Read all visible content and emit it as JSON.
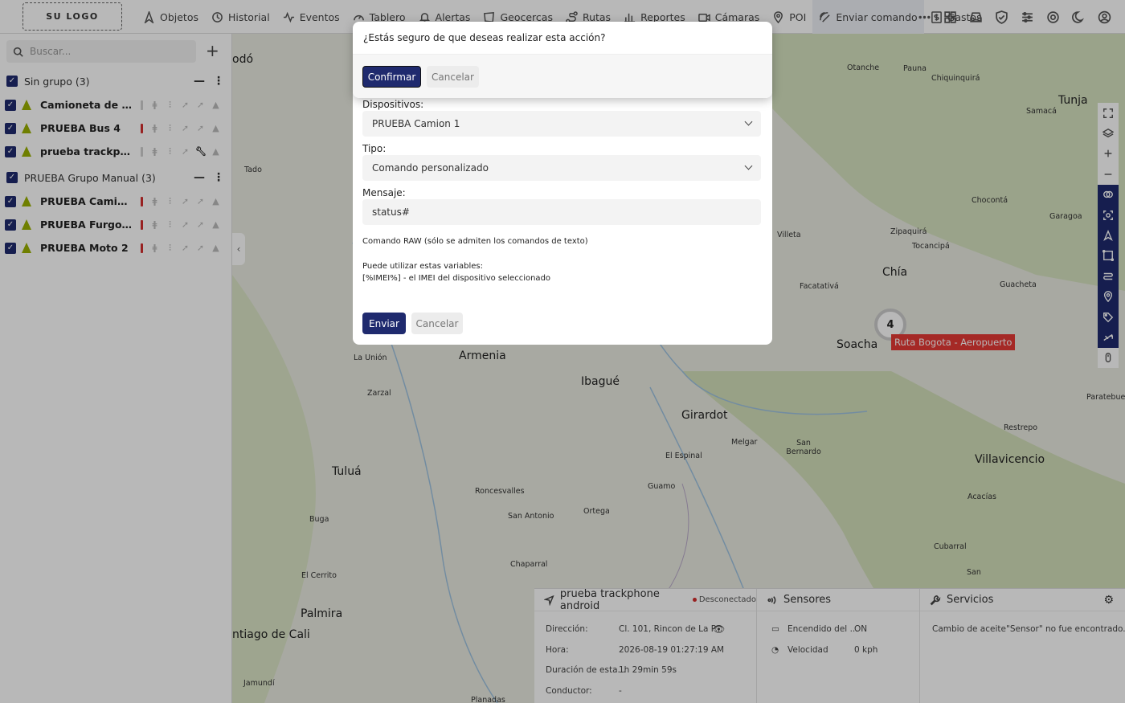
{
  "header": {
    "logo": "SU LOGO",
    "nav": [
      {
        "label": "Objetos",
        "icon": "navigation-icon"
      },
      {
        "label": "Historial",
        "icon": "history-icon"
      },
      {
        "label": "Eventos",
        "icon": "activity-icon"
      },
      {
        "label": "Tablero",
        "icon": "gauge-icon"
      },
      {
        "label": "Alertas",
        "icon": "bell-icon"
      },
      {
        "label": "Geocercas",
        "icon": "geofence-icon"
      },
      {
        "label": "Rutas",
        "icon": "route-icon"
      },
      {
        "label": "Reportes",
        "icon": "chart-bar-icon"
      },
      {
        "label": "Cámaras",
        "icon": "camera-icon"
      },
      {
        "label": "POI",
        "icon": "poi-icon"
      },
      {
        "label": "Enviar comando",
        "icon": "send-command-icon"
      },
      {
        "label": "Gastos",
        "icon": "dollar-icon"
      }
    ],
    "right_icons": [
      "more-icon",
      "apps-grid-icon",
      "inbox-icon",
      "shield-icon",
      "sliders-icon",
      "support-icon",
      "moon-icon",
      "user-icon"
    ]
  },
  "sidebar": {
    "search_placeholder": "Buscar...",
    "groups": [
      {
        "name": "Sin grupo (3)",
        "devices": [
          {
            "name": "Camioneta de rep...",
            "status_color": "#cccccc",
            "tools": false
          },
          {
            "name": "PRUEBA Bus 4",
            "status_color": "#d32f2f",
            "tools": false
          },
          {
            "name": "prueba trackphon...",
            "status_color": "#cccccc",
            "tools": true
          }
        ]
      },
      {
        "name": "PRUEBA Grupo Manual (3)",
        "devices": [
          {
            "name": "PRUEBA Camion 1",
            "status_color": "#d32f2f",
            "tools": false
          },
          {
            "name": "PRUEBA Furgon 3",
            "status_color": "#d32f2f",
            "tools": false
          },
          {
            "name": "PRUEBA Moto 2",
            "status_color": "#d32f2f",
            "tools": false
          }
        ]
      }
    ]
  },
  "map": {
    "cities": [
      {
        "name": "odó",
        "size": "big"
      },
      {
        "name": "Armenia",
        "size": "big"
      },
      {
        "name": "Ibagué",
        "size": "big"
      },
      {
        "name": "Girardot",
        "size": "big"
      },
      {
        "name": "Tuluá",
        "size": "big"
      },
      {
        "name": "Palmira",
        "size": "big"
      },
      {
        "name": "ntiago de Cali",
        "size": "big"
      },
      {
        "name": "Chía",
        "size": "big"
      },
      {
        "name": "Soacha",
        "size": "big"
      },
      {
        "name": "Tunja",
        "size": "big"
      },
      {
        "name": "Villavicencio",
        "size": "big"
      },
      {
        "name": "Otanche",
        "size": "sm"
      },
      {
        "name": "Pauna",
        "size": "sm"
      },
      {
        "name": "Chiquinquirá",
        "size": "sm"
      },
      {
        "name": "Samacá",
        "size": "sm"
      },
      {
        "name": "Chocontá",
        "size": "sm"
      },
      {
        "name": "Garagoa",
        "size": "sm"
      },
      {
        "name": "Zipaquirá",
        "size": "sm"
      },
      {
        "name": "Tocancipá",
        "size": "sm"
      },
      {
        "name": "Villeta",
        "size": "sm"
      },
      {
        "name": "Facatativá",
        "size": "sm"
      },
      {
        "name": "Guacheta",
        "size": "sm"
      },
      {
        "name": "Tado",
        "size": "sm"
      },
      {
        "name": "La Unión",
        "size": "sm"
      },
      {
        "name": "Zarzal",
        "size": "sm"
      },
      {
        "name": "Melgar",
        "size": "sm"
      },
      {
        "name": "San Bernardo",
        "size": "sm"
      },
      {
        "name": "El Espinal",
        "size": "sm"
      },
      {
        "name": "Restrepo",
        "size": "sm"
      },
      {
        "name": "Paratebueno",
        "size": "sm"
      },
      {
        "name": "Guamo",
        "size": "sm"
      },
      {
        "name": "Roncesvalles",
        "size": "sm"
      },
      {
        "name": "San Antonio",
        "size": "sm"
      },
      {
        "name": "Ortega",
        "size": "sm"
      },
      {
        "name": "Acacías",
        "size": "sm"
      },
      {
        "name": "Buga",
        "size": "sm"
      },
      {
        "name": "El Cerrito",
        "size": "sm"
      },
      {
        "name": "Chaparral",
        "size": "sm"
      },
      {
        "name": "Cubarral",
        "size": "sm"
      },
      {
        "name": "San",
        "size": "sm"
      },
      {
        "name": "Jamundí",
        "size": "sm"
      },
      {
        "name": "Planadas",
        "size": "sm"
      }
    ],
    "cluster_count": "4",
    "route_label": "Ruta Bogota - Aeropuerto",
    "tools": [
      "fullscreen-icon",
      "layers-icon",
      "zoom-in-icon",
      "zoom-out-icon",
      "geofence-toggle-icon",
      "fit-icon",
      "objects-toggle-icon",
      "route-toggle-icon",
      "routes-toggle-icon",
      "poi-toggle-icon",
      "tags-icon",
      "traffic-icon",
      "mouse-icon"
    ]
  },
  "bottom": {
    "device": {
      "name": "prueba trackphone android",
      "status": "Desconectado",
      "rows": [
        {
          "label": "Dirección:",
          "value": "Cl. 101, Rincon de La P..."
        },
        {
          "label": "Hora:",
          "value": "2026-08-19 01:27:19 AM"
        },
        {
          "label": "Duración de esta...",
          "value": "1h 29min 59s"
        },
        {
          "label": "Conductor:",
          "value": "-"
        }
      ]
    },
    "sensors": {
      "title": "Sensores",
      "rows": [
        {
          "label": "Encendido del ...",
          "value": "ON"
        },
        {
          "label": "Velocidad",
          "value": "0 kph"
        }
      ]
    },
    "services": {
      "title": "Servicios",
      "row_label": "Cambio de aceite",
      "row_value": "\"Sensor\" no fue encontrado."
    }
  },
  "command_modal": {
    "devices_label": "Dispositivos:",
    "devices_value": "PRUEBA Camion 1",
    "type_label": "Tipo:",
    "type_value": "Comando personalizado",
    "message_label": "Mensaje:",
    "message_value": "status#",
    "raw_note": "Comando RAW (sólo se admiten los comandos de texto)",
    "vars_title": "Puede utilizar estas variables:",
    "vars_item": "[%IMEI%] - el IMEI del dispositivo seleccionado",
    "send_label": "Enviar",
    "cancel_label": "Cancelar"
  },
  "confirm_modal": {
    "question": "¿Estás seguro de que deseas realizar esta acción?",
    "confirm_label": "Confirmar",
    "cancel_label": "Cancelar"
  }
}
